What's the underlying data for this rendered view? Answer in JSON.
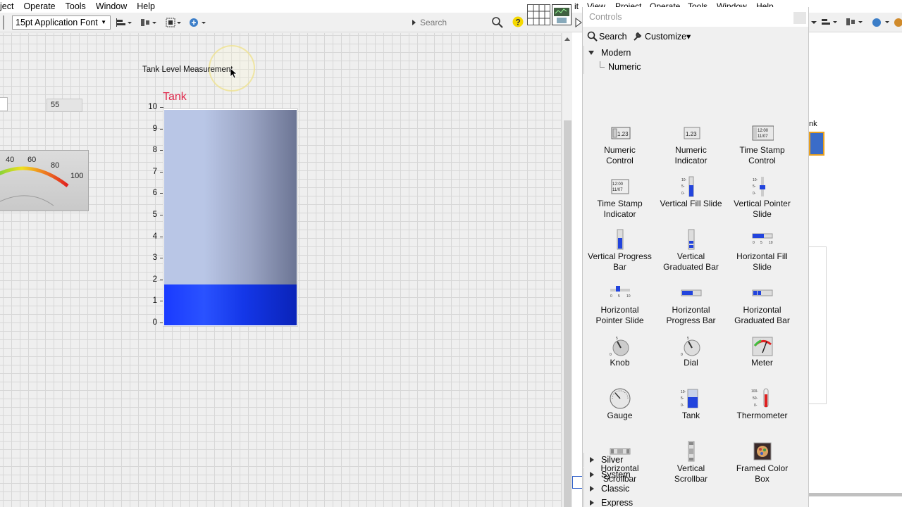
{
  "front_panel": {
    "menu": [
      "ject",
      "Operate",
      "Tools",
      "Window",
      "Help"
    ],
    "font_dropdown": "15pt Application Font",
    "search_placeholder": "Search",
    "numeric_value": "55",
    "meter_labels": [
      "40",
      "60",
      "80",
      "100"
    ],
    "tank_caption": "Tank Level Measurement",
    "tank_label": "Tank",
    "tank_scale": [
      "0",
      "1",
      "2",
      "3",
      "4",
      "5",
      "6",
      "7",
      "8",
      "9",
      "10"
    ],
    "tank_level": 1.9,
    "tank_max": 10
  },
  "block_diagram": {
    "menu": [
      "it",
      "View",
      "Project",
      "Operate",
      "Tools",
      "Window",
      "Help"
    ],
    "fragment_text": "nk"
  },
  "palette": {
    "title": "Controls",
    "search_label": "Search",
    "customize_label": "Customize▾",
    "tree": {
      "modern": "Modern",
      "numeric": "Numeric"
    },
    "items": [
      [
        "Numeric",
        "Control"
      ],
      [
        "Numeric",
        "Indicator"
      ],
      [
        "Time Stamp",
        "Control"
      ],
      [
        "Time Stamp",
        "Indicator"
      ],
      [
        "Vertical Fill Slide",
        ""
      ],
      [
        "Vertical Pointer",
        "Slide"
      ],
      [
        "Vertical Progress",
        "Bar"
      ],
      [
        "Vertical",
        "Graduated Bar"
      ],
      [
        "Horizontal Fill",
        "Slide"
      ],
      [
        "Horizontal",
        "Pointer Slide"
      ],
      [
        "Horizontal",
        "Progress Bar"
      ],
      [
        "Horizontal",
        "Graduated Bar"
      ],
      [
        "Knob",
        ""
      ],
      [
        "Dial",
        ""
      ],
      [
        "Meter",
        ""
      ],
      [
        "Gauge",
        ""
      ],
      [
        "Tank",
        ""
      ],
      [
        "Thermometer",
        ""
      ],
      [
        "Horizontal",
        "Scrollbar"
      ],
      [
        "Vertical",
        "Scrollbar"
      ],
      [
        "Framed Color",
        "Box"
      ]
    ],
    "sections": [
      "Silver",
      "System",
      "Classic",
      "Express"
    ]
  },
  "colors": {
    "tank_fill": "#1a3bff",
    "tank_label": "#e0284b",
    "meter_red": "#e02020"
  }
}
